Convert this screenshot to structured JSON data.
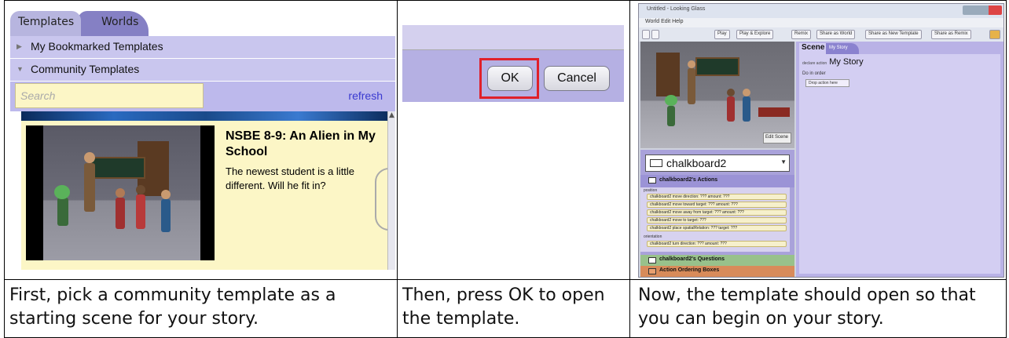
{
  "panel1": {
    "tabs": [
      "Templates",
      "Worlds"
    ],
    "sections": [
      "My Bookmarked Templates",
      "Community Templates"
    ],
    "search_placeholder": "Search",
    "refresh_label": "refresh",
    "card_title": "NSBE 8-9: An Alien in My School",
    "card_description": "The newest student is a little different. Will he fit in?"
  },
  "panel2": {
    "ok_label": "OK",
    "cancel_label": "Cancel"
  },
  "panel3": {
    "window_title": "Untitled - Looking Glass",
    "menu": "World  Edit  Help",
    "toolbar_buttons": [
      "Play",
      "Play & Explore",
      "Remix",
      "Share as World",
      "Share as New Template",
      "Share as Remix"
    ],
    "edit_scene": "Edit Scene",
    "selected_object": "chalkboard2",
    "actions_header": "chalkboard2's Actions",
    "position_label": "position",
    "orientation_label": "orientation",
    "action_rows": [
      "chalkboard2 move  direction: ???  amount: ???",
      "chalkboard2 move toward  target: ???  amount: ???",
      "chalkboard2 move away from  target: ???  amount: ???",
      "chalkboard2 move to  target: ???",
      "chalkboard2 place  spatialRelation: ???  target: ???"
    ],
    "orientation_rows": [
      "chalkboard2 turn  direction: ???  amount: ???"
    ],
    "questions_header": "chalkboard2's Questions",
    "ordering_header": "Action Ordering Boxes",
    "tab_scene": "Scene",
    "tab_mystory": "My Story",
    "story_prefix": "declare action",
    "story_title": "My Story",
    "do_in_order": "Do in order",
    "drop_box": "Drop action here"
  },
  "captions": [
    "First, pick a community template as a starting scene for your story.",
    "Then, press OK to open the template.",
    "Now, the template should open so that you can begin on your story."
  ]
}
